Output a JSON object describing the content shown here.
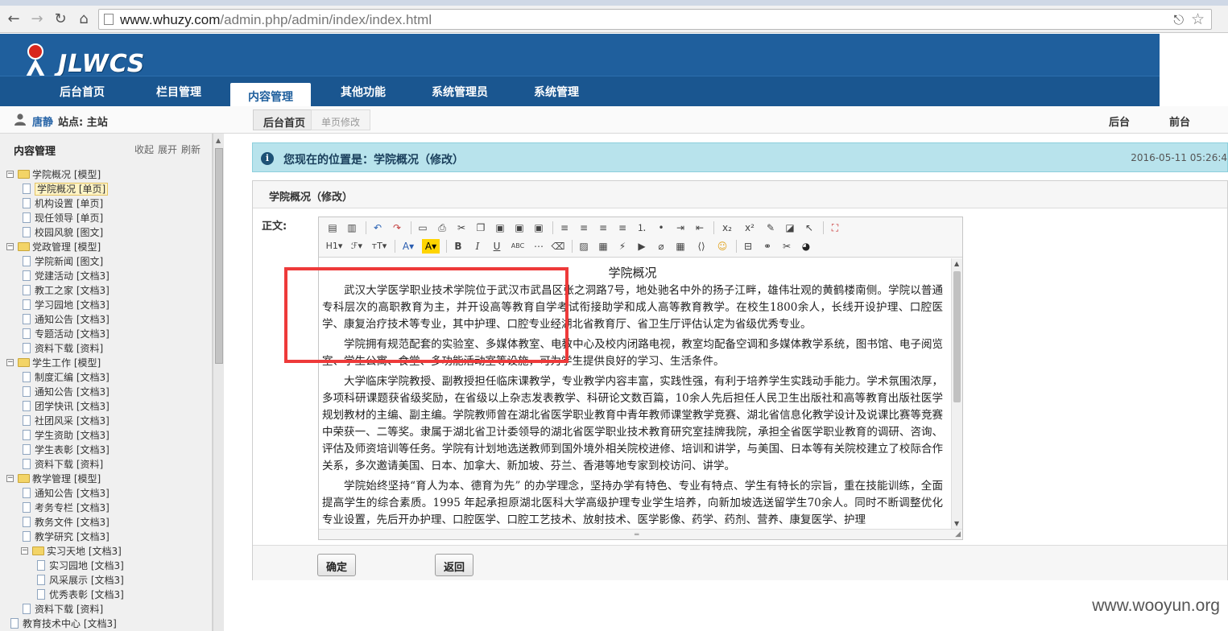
{
  "browser": {
    "url_host": "www.whuzy.com",
    "url_path": "/admin.php/admin/index/index.html"
  },
  "app": {
    "logo_text": "JLWCS",
    "nav": [
      "后台首页",
      "栏目管理",
      "内容管理",
      "其他功能",
      "系统管理员",
      "系统管理"
    ],
    "active_nav": "内容管理"
  },
  "status": {
    "user": "唐静",
    "site": "站点: 主站",
    "crumb_home": "后台首页",
    "crumb_current": "单页修改",
    "link_backend": "后台",
    "link_frontend": "前台"
  },
  "sidebar": {
    "title": "内容管理",
    "actions": [
      "收起",
      "展开",
      "刷新"
    ],
    "tree": [
      {
        "label": "学院概况 [模型]",
        "type": "folder",
        "level": 0
      },
      {
        "label": "学院概况 [单页]",
        "type": "doc",
        "level": 1,
        "selected": true
      },
      {
        "label": "机构设置 [单页]",
        "type": "doc",
        "level": 1
      },
      {
        "label": "现任领导 [单页]",
        "type": "doc",
        "level": 1
      },
      {
        "label": "校园风貌 [图文]",
        "type": "doc",
        "level": 1
      },
      {
        "label": "党政管理 [模型]",
        "type": "folder",
        "level": 0
      },
      {
        "label": "学院新闻 [图文]",
        "type": "doc",
        "level": 1
      },
      {
        "label": "党建活动 [文档3]",
        "type": "doc",
        "level": 1
      },
      {
        "label": "教工之家 [文档3]",
        "type": "doc",
        "level": 1
      },
      {
        "label": "学习园地 [文档3]",
        "type": "doc",
        "level": 1
      },
      {
        "label": "通知公告 [文档3]",
        "type": "doc",
        "level": 1
      },
      {
        "label": "专题活动 [文档3]",
        "type": "doc",
        "level": 1
      },
      {
        "label": "资料下载 [资料]",
        "type": "doc",
        "level": 1
      },
      {
        "label": "学生工作 [模型]",
        "type": "folder",
        "level": 0
      },
      {
        "label": "制度汇编 [文档3]",
        "type": "doc",
        "level": 1
      },
      {
        "label": "通知公告 [文档3]",
        "type": "doc",
        "level": 1
      },
      {
        "label": "团学快讯 [文档3]",
        "type": "doc",
        "level": 1
      },
      {
        "label": "社团风采 [文档3]",
        "type": "doc",
        "level": 1
      },
      {
        "label": "学生资助 [文档3]",
        "type": "doc",
        "level": 1
      },
      {
        "label": "学生表彰 [文档3]",
        "type": "doc",
        "level": 1
      },
      {
        "label": "资料下载 [资料]",
        "type": "doc",
        "level": 1
      },
      {
        "label": "教学管理 [模型]",
        "type": "folder",
        "level": 0
      },
      {
        "label": "通知公告 [文档3]",
        "type": "doc",
        "level": 1
      },
      {
        "label": "考务专栏 [文档3]",
        "type": "doc",
        "level": 1
      },
      {
        "label": "教务文件 [文档3]",
        "type": "doc",
        "level": 1
      },
      {
        "label": "教学研究 [文档3]",
        "type": "doc",
        "level": 1
      },
      {
        "label": "实习天地 [文档3]",
        "type": "folder",
        "level": 1
      },
      {
        "label": "实习园地 [文档3]",
        "type": "doc",
        "level": 2
      },
      {
        "label": "风采展示 [文档3]",
        "type": "doc",
        "level": 2
      },
      {
        "label": "优秀表彰 [文档3]",
        "type": "doc",
        "level": 2
      },
      {
        "label": "资料下载 [资料]",
        "type": "doc",
        "level": 1
      },
      {
        "label": "教育技术中心 [文档3]",
        "type": "doc",
        "level": 0
      }
    ]
  },
  "location": {
    "text": "您现在的位置是：学院概况（修改）",
    "time": "2016-05-11 05:26:4"
  },
  "form": {
    "panel_title": "学院概况（修改）",
    "body_label": "正文:",
    "confirm": "确定",
    "back": "返回"
  },
  "editor": {
    "heading": "学院概况",
    "paragraphs": [
      "武汉大学医学职业技术学院位于武汉市武昌区张之洞路7号，地处驰名中外的扬子江畔，雄伟壮观的黄鹤楼南侧。学院以普通专科层次的高职教育为主，并开设高等教育自学考试衔接助学和成人高等教育教学。在校生1800余人，长线开设护理、口腔医学、康复治疗技术等专业，其中护理、口腔专业经湖北省教育厅、省卫生厅评估认定为省级优秀专业。",
      "学院拥有规范配套的实验室、多媒体教室、电教中心及校内闭路电视，教室均配备空调和多媒体教学系统，图书馆、电子阅览室、学生公寓、食堂、多功能活动室等设施，可为学生提供良好的学习、生活条件。",
      "大学临床学院教授、副教授担任临床课教学，专业教学内容丰富，实践性强，有利于培养学生实践动手能力。学术氛围浓厚，多项科研课题获省级奖励，在省级以上杂志发表教学、科研论文数百篇，10余人先后担任人民卫生出版社和高等教育出版社医学规划教材的主编、副主编。学院教师曾在湖北省医学职业教育中青年教师课堂教学竞赛、湖北省信息化教学设计及说课比赛等竞赛中荣获一、二等奖。隶属于湖北省卫计委领导的湖北省医学职业技术教育研究室挂牌我院，承担全省医学职业教育的调研、咨询、评估及师资培训等任务。学院有计划地选送教师到国外境外相关院校进修、培训和讲学，与美国、日本等有关院校建立了校际合作关系，多次邀请美国、日本、加拿大、新加坡、芬兰、香港等地专家到校访问、讲学。",
      "学院始终坚持“育人为本、德育为先” 的办学理念，坚持办学有特色、专业有特点、学生有特长的宗旨，重在技能训练，全面提高学生的综合素质。1995 年起承担原湖北医科大学高级护理专业学生培养，向新加坡选送留学生70余人。同时不断调整优化专业设置，先后开办护理、口腔医学、口腔工艺技术、放射技术、医学影像、药学、药剂、营养、康复医学、护理"
    ],
    "toolbar_row1": [
      "source",
      "template",
      "undo",
      "redo",
      "preview",
      "print",
      "cut",
      "copy",
      "paste",
      "paste-text",
      "paste-word",
      "align-left",
      "align-center",
      "align-right",
      "justify",
      "ordered-list",
      "bullet-list",
      "indent",
      "outdent",
      "subscript",
      "superscript",
      "clear-format",
      "select-all",
      "select",
      "fullscreen"
    ],
    "toolbar_row2": [
      "heading",
      "font-family",
      "font-size",
      "font-color",
      "highlight-color",
      "bold",
      "italic",
      "underline",
      "strikethrough",
      "horizontal-rule",
      "remove-format",
      "image",
      "multi-image",
      "flash",
      "media",
      "attachment",
      "table",
      "code",
      "emoticon",
      "page-break",
      "link",
      "unlink",
      "qq"
    ]
  },
  "watermark": "www.wooyun.org",
  "colors": {
    "header_blue": "#1f5f9d",
    "nav_blue": "#1a5690",
    "location_bar": "#b8e3ec",
    "highlight_red": "#ee3a3a"
  }
}
